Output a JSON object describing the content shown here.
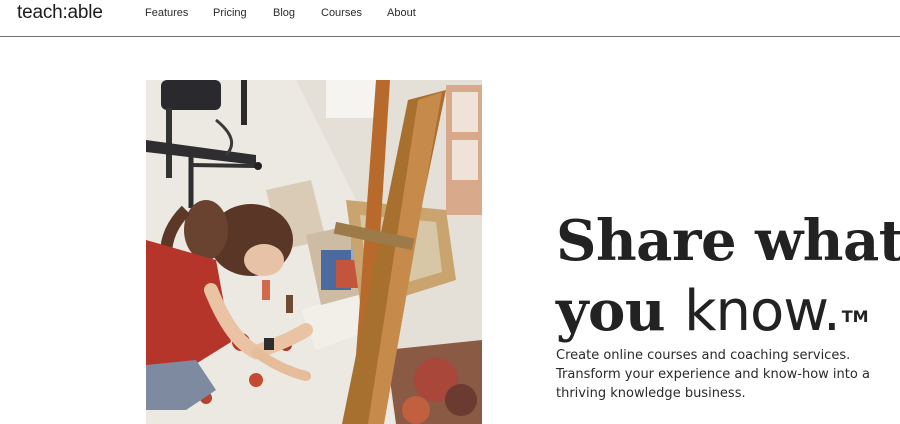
{
  "brand": {
    "logo_text": "teach:able"
  },
  "nav": {
    "items": [
      {
        "label": "Features"
      },
      {
        "label": "Pricing"
      },
      {
        "label": "Blog"
      },
      {
        "label": "Courses"
      },
      {
        "label": "About"
      }
    ]
  },
  "hero": {
    "headline_line1": "Share what",
    "headline_line2_regular": "you ",
    "headline_line2_bold": "know.",
    "trademark": "TM",
    "subtext_lines": [
      "Create online courses and coaching services.",
      "Transform your experience and know-how into a",
      "thriving knowledge business."
    ]
  }
}
